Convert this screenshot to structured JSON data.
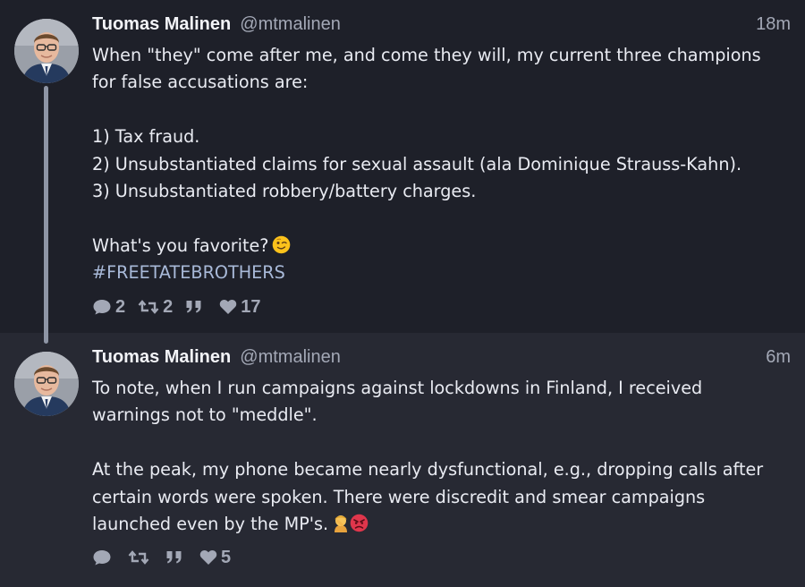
{
  "tweets": [
    {
      "display_name": "Tuomas Malinen",
      "handle": "@mtmalinen",
      "timestamp": "18m",
      "lines": [
        "When \"they\" come after me, and come they will, my current three champions",
        "for false accusations are:",
        "",
        "1) Tax fraud.",
        "2) Unsubstantiated claims for sexual assault (ala Dominique Strauss-Kahn).",
        "3) Unsubstantiated robbery/battery charges.",
        "",
        "What's you favorite?"
      ],
      "hashtag": "#FREETATEBROTHERS",
      "emoji": "winking-face-emoji",
      "actions": {
        "replies": "2",
        "retweets": "2",
        "quotes": "",
        "likes": "17"
      }
    },
    {
      "display_name": "Tuomas Malinen",
      "handle": "@mtmalinen",
      "timestamp": "6m",
      "lines": [
        "To note, when I run campaigns against lockdowns in Finland, I received",
        "warnings not to \"meddle\".",
        "",
        "At the peak, my phone became nearly dysfunctional, e.g., dropping calls after",
        "certain words were spoken. There were discredit and smear campaigns",
        "launched even by the MP's."
      ],
      "emoji": "facepalm-and-angry-face-emoji",
      "actions": {
        "replies": "",
        "retweets": "",
        "quotes": "",
        "likes": "5"
      }
    }
  ],
  "colors": {
    "background": "#1e2029",
    "background_alt": "#272933",
    "text": "#e9ebf2",
    "muted": "#a3a8b6",
    "hashtag": "#a8b9d8",
    "thread_line": "#8e95a5"
  }
}
